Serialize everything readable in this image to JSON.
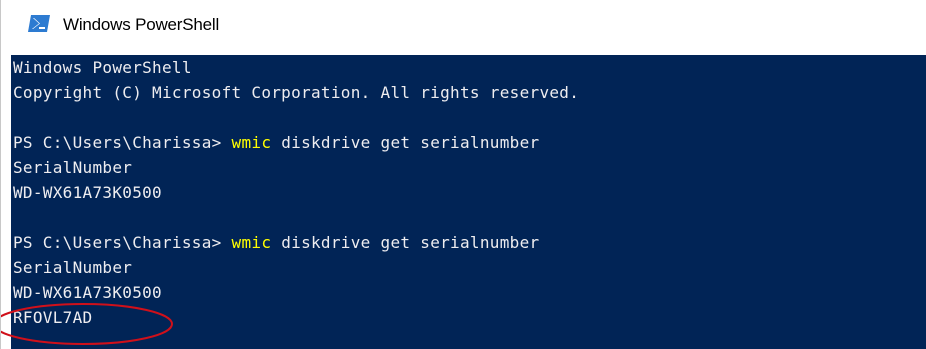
{
  "window": {
    "title": "Windows PowerShell",
    "icon": "powershell-icon"
  },
  "console": {
    "background": "#012456",
    "foreground": "#eeedf0",
    "command_color": "#ffff00",
    "lines": [
      {
        "text": "Windows PowerShell"
      },
      {
        "text": "Copyright (C) Microsoft Corporation. All rights reserved."
      },
      {
        "prompt": "PS C:\\Users\\Charissa> ",
        "command": "wmic",
        "args": " diskdrive get serialnumber"
      },
      {
        "text": "SerialNumber"
      },
      {
        "text": "WD-WX61A73K0500"
      },
      {
        "prompt": "PS C:\\Users\\Charissa> ",
        "command": "wmic",
        "args": " diskdrive get serialnumber"
      },
      {
        "text": "SerialNumber"
      },
      {
        "text": "WD-WX61A73K0500"
      },
      {
        "text": "RFOVL7AD"
      }
    ]
  },
  "annotation": {
    "type": "ellipse",
    "color": "#d0101a"
  }
}
